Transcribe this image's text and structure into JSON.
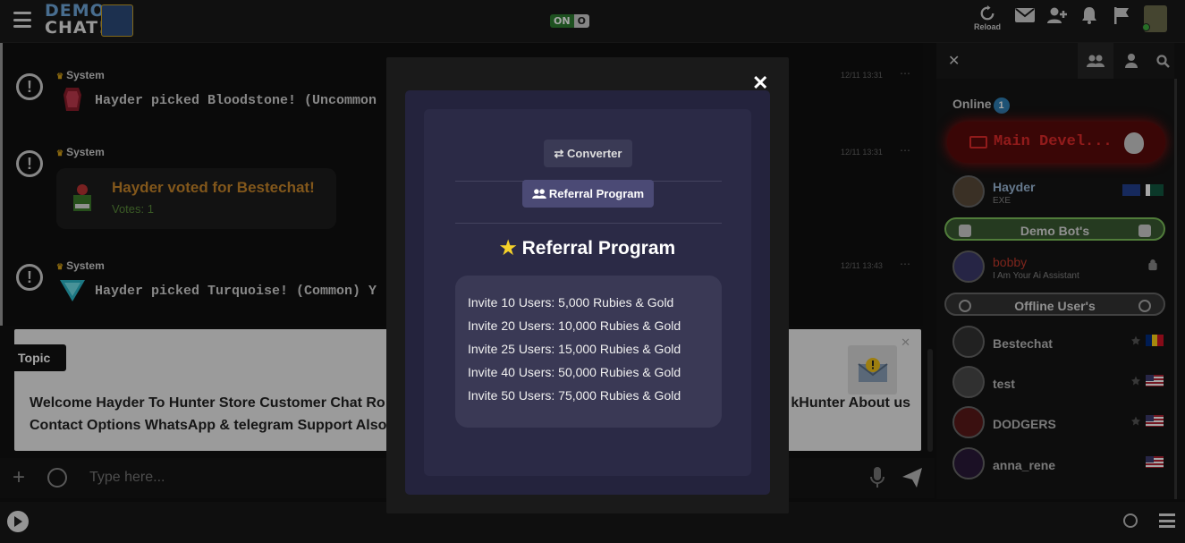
{
  "header": {
    "logo_line1": "DEMO",
    "logo_line2": "CHAT!",
    "toggle_on": "ON",
    "toggle_off": "O",
    "reload_label": "Reload"
  },
  "messages": [
    {
      "sender": "System",
      "time": "12/11 13:31",
      "text": "Hayder picked Bloodstone! (Uncommon"
    },
    {
      "sender": "System",
      "time": "12/11 13:31",
      "vote_title": "Hayder voted for Bestechat!",
      "vote_count": "Votes: 1"
    },
    {
      "sender": "System",
      "time": "12/11 13:43",
      "text": "Hayder picked Turquoise! (Common) Y"
    }
  ],
  "topic": {
    "label": "Topic",
    "text_left": "Welcome Hayder To Hunter Store Customer Chat Ro",
    "text_right": "kHunter About us",
    "text_line2": "Contact Options WhatsApp & telegram Support Also"
  },
  "input": {
    "placeholder": "Type here..."
  },
  "sidebar": {
    "online_label": "Online",
    "online_count": "1",
    "main_dev": "Main Devel...",
    "users_top": [
      {
        "name": "Hayder",
        "mood": "EXE"
      }
    ],
    "bots_label": "Demo Bot's",
    "bot": {
      "name": "bobby",
      "mood": "I Am Your Ai Assistant"
    },
    "offline_label": "Offline User's",
    "offline_users": [
      {
        "name": "Bestechat"
      },
      {
        "name": "test"
      },
      {
        "name": "DODGERS"
      },
      {
        "name": "anna_rene"
      }
    ]
  },
  "modal": {
    "converter_label": "Converter",
    "referral_tab_label": "Referral Program",
    "title": "Referral Program",
    "rewards": [
      "Invite 10 Users: 5,000 Rubies & Gold",
      "Invite 20 Users: 10,000 Rubies & Gold",
      "Invite 25 Users: 15,000 Rubies & Gold",
      "Invite 40 Users: 50,000 Rubies & Gold",
      "Invite 50 Users: 75,000 Rubies & Gold"
    ]
  },
  "colors": {
    "modal_bg": "#24233d",
    "accent_red": "#e02a2a",
    "vote_orange": "#c8862a",
    "star": "#f5d12a"
  }
}
